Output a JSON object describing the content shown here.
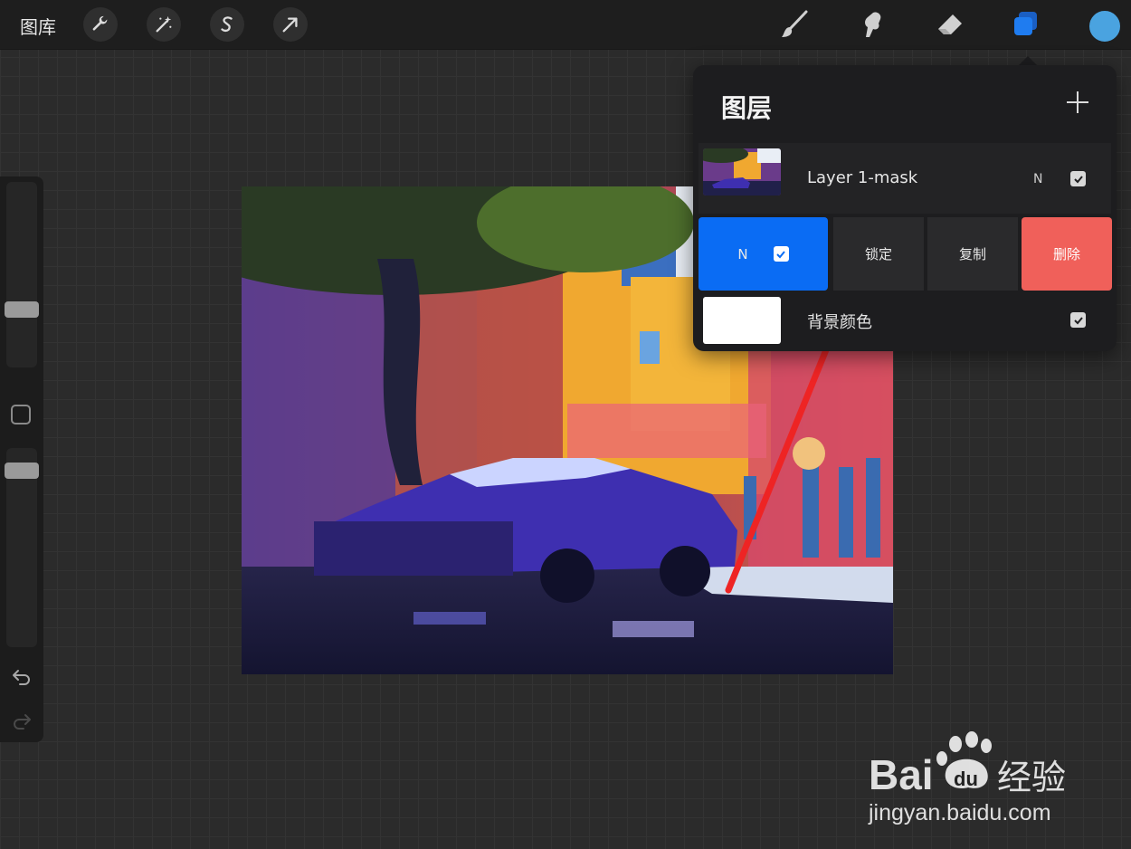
{
  "topbar": {
    "gallery_label": "图库",
    "left_tools": [
      "wrench-icon",
      "magic-wand-icon",
      "selection-s-icon",
      "transform-arrow-icon"
    ],
    "right_tools": [
      "brush-icon",
      "smudge-icon",
      "eraser-icon",
      "layers-icon"
    ],
    "active_tool": "layers-icon",
    "current_color": "#4aa3e0"
  },
  "sidebar": {
    "undo": "undo-icon",
    "redo": "redo-icon"
  },
  "layers_panel": {
    "title": "图层",
    "add_icon": "plus-icon",
    "layers": [
      {
        "name": "Layer 1-mask",
        "blend_mode": "N",
        "visible": true
      },
      {
        "name": "背景颜色",
        "visible": true
      }
    ],
    "actions": {
      "blend_mode": "N",
      "lock": "锁定",
      "duplicate": "复制",
      "delete": "删除"
    }
  },
  "colors": {
    "accent_blue": "#0a6cf4",
    "delete_red": "#f0605a",
    "active_layers_blue": "#1f7cf0"
  },
  "watermark": {
    "brand": "Bai",
    "brand_suffix": "du",
    "product": "经验",
    "url": "jingyan.baidu.com"
  }
}
